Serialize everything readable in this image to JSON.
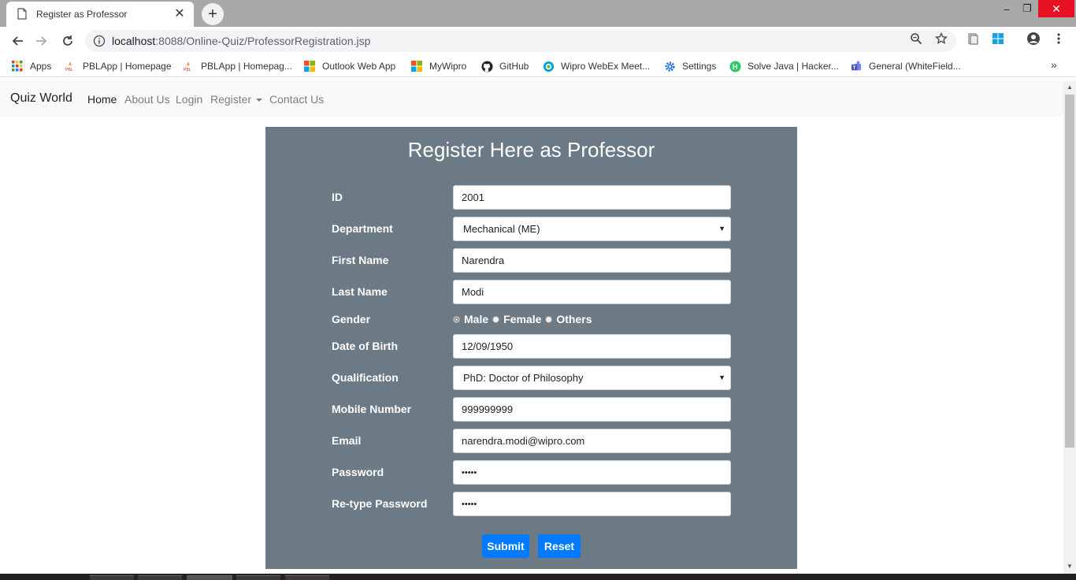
{
  "browser": {
    "tab_title": "Register as Professor",
    "tab_close": "✕",
    "new_tab": "+",
    "url_host": "localhost",
    "url_path": ":8088/Online-Quiz/ProfessorRegistration.jsp",
    "window_controls": {
      "minimize": "–",
      "maximize": "❐",
      "close": "✕"
    }
  },
  "bookmarks": [
    {
      "label": "Apps",
      "icon": "apps-grid-icon"
    },
    {
      "label": "PBLApp | Homepage",
      "icon": "pbl-icon"
    },
    {
      "label": "PBLApp | Homepag...",
      "icon": "pbl-icon"
    },
    {
      "label": "Outlook Web App",
      "icon": "windows-logo-icon"
    },
    {
      "label": "MyWipro",
      "icon": "windows-logo-icon"
    },
    {
      "label": "GitHub",
      "icon": "github-icon"
    },
    {
      "label": "Wipro WebEx Meet...",
      "icon": "webex-icon"
    },
    {
      "label": "Settings",
      "icon": "gear-icon"
    },
    {
      "label": "Solve Java | Hacker...",
      "icon": "hackerrank-icon"
    },
    {
      "label": "General (WhiteField...",
      "icon": "teams-icon"
    }
  ],
  "bookmarks_more": "»",
  "navbar": {
    "brand": "Quiz World",
    "links": [
      "Home",
      "About Us",
      "Login",
      "Register",
      "Contact Us"
    ]
  },
  "form": {
    "title": "Register Here as Professor",
    "labels": {
      "id": "ID",
      "department": "Department",
      "first_name": "First Name",
      "last_name": "Last Name",
      "gender": "Gender",
      "dob": "Date of Birth",
      "qualification": "Qualification",
      "mobile": "Mobile Number",
      "email": "Email",
      "password": "Password",
      "retype_password": "Re-type Password"
    },
    "values": {
      "id": "2001",
      "department": "Mechanical (ME)",
      "first_name": "Narendra",
      "last_name": "Modi",
      "dob": "12/09/1950",
      "qualification": "PhD: Doctor of Philosophy",
      "mobile": "999999999",
      "email": "narendra.modi@wipro.com",
      "password": "•••••",
      "retype_password": "•••••"
    },
    "gender_options": [
      "Male",
      "Female",
      "Others"
    ],
    "gender_selected": "Male",
    "select_arrow": "▼",
    "buttons": {
      "submit": "Submit",
      "reset": "Reset"
    }
  },
  "scrollbar": {
    "up": "▲",
    "down": "▼"
  },
  "colors": {
    "panel": "#6c7a86",
    "primary_button": "#007bff",
    "navbar_bg": "#f8f9fa",
    "close_button": "#e81123"
  }
}
